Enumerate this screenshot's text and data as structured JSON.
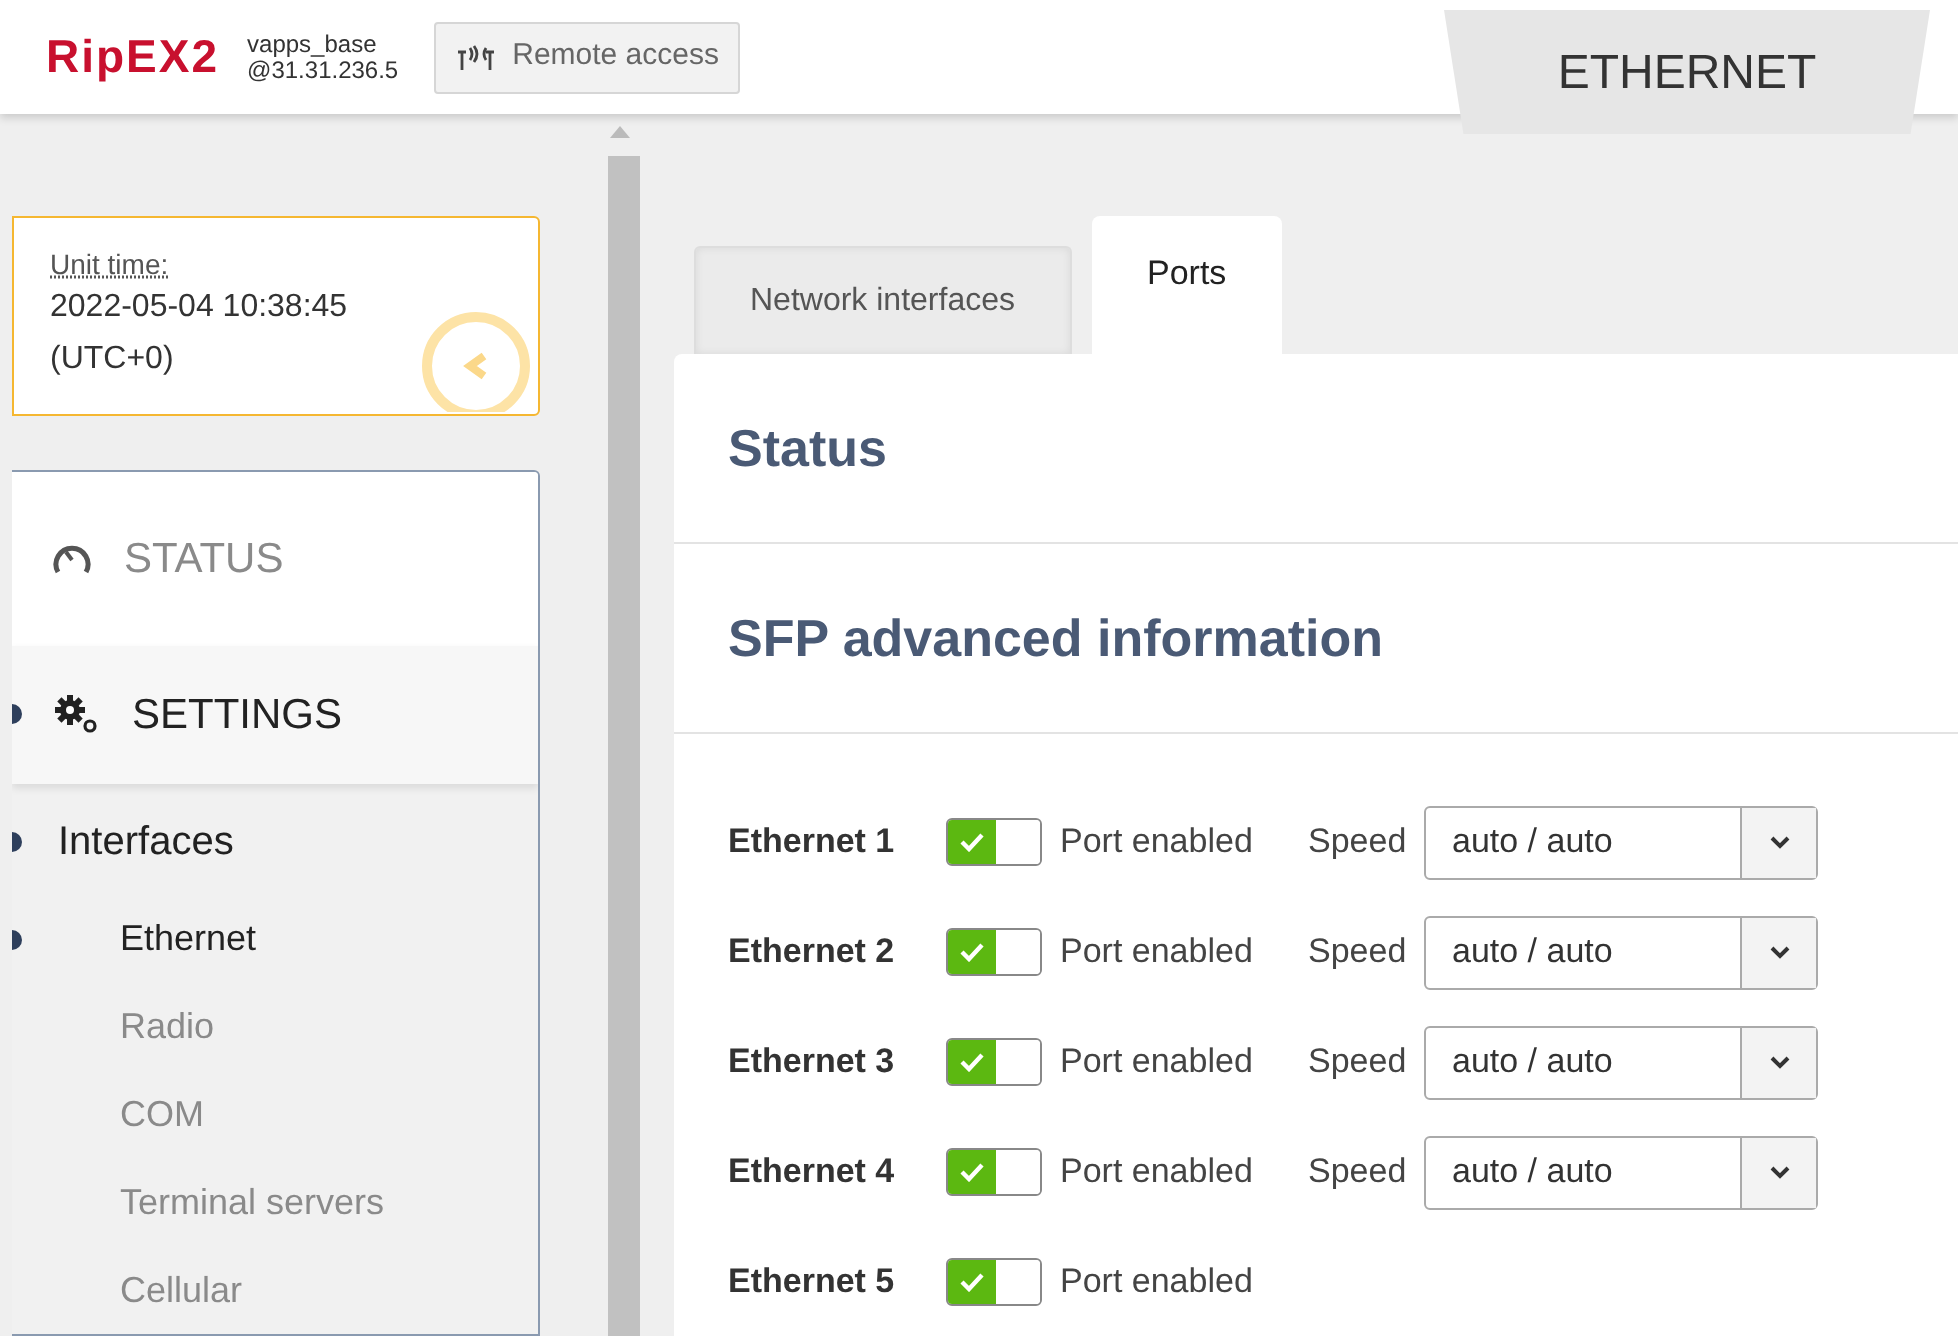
{
  "header": {
    "logo": "RipEX2",
    "device_name": "vapps_base",
    "device_address": "@31.31.236.5",
    "remote_access": "Remote access",
    "page_tab": "ETHERNET"
  },
  "unit_time": {
    "label": "Unit time:",
    "value": "2022-05-04 10:38:45",
    "zone": "(UTC+0)"
  },
  "nav": [
    {
      "label": "STATUS",
      "kind": "section",
      "selected": false
    },
    {
      "label": "SETTINGS",
      "kind": "section",
      "selected": true
    },
    {
      "label": "Interfaces",
      "kind": "group",
      "selected": true
    },
    {
      "label": "Ethernet",
      "kind": "item",
      "selected": true
    },
    {
      "label": "Radio",
      "kind": "item",
      "selected": false
    },
    {
      "label": "COM",
      "kind": "item",
      "selected": false
    },
    {
      "label": "Terminal servers",
      "kind": "item",
      "selected": false
    },
    {
      "label": "Cellular",
      "kind": "item",
      "selected": false
    }
  ],
  "tabs": [
    {
      "label": "Network interfaces",
      "selected": false
    },
    {
      "label": "Ports",
      "selected": true
    }
  ],
  "sections": [
    "Status",
    "SFP advanced information"
  ],
  "ports": [
    {
      "name": "Ethernet 1",
      "enabled": true,
      "enabled_label": "Port enabled",
      "speed_label": "Speed",
      "speed": "auto / auto"
    },
    {
      "name": "Ethernet 2",
      "enabled": true,
      "enabled_label": "Port enabled",
      "speed_label": "Speed",
      "speed": "auto / auto"
    },
    {
      "name": "Ethernet 3",
      "enabled": true,
      "enabled_label": "Port enabled",
      "speed_label": "Speed",
      "speed": "auto / auto"
    },
    {
      "name": "Ethernet 4",
      "enabled": true,
      "enabled_label": "Port enabled",
      "speed_label": "Speed",
      "speed": "auto / auto"
    },
    {
      "name": "Ethernet 5",
      "enabled": true,
      "enabled_label": "Port enabled"
    }
  ]
}
